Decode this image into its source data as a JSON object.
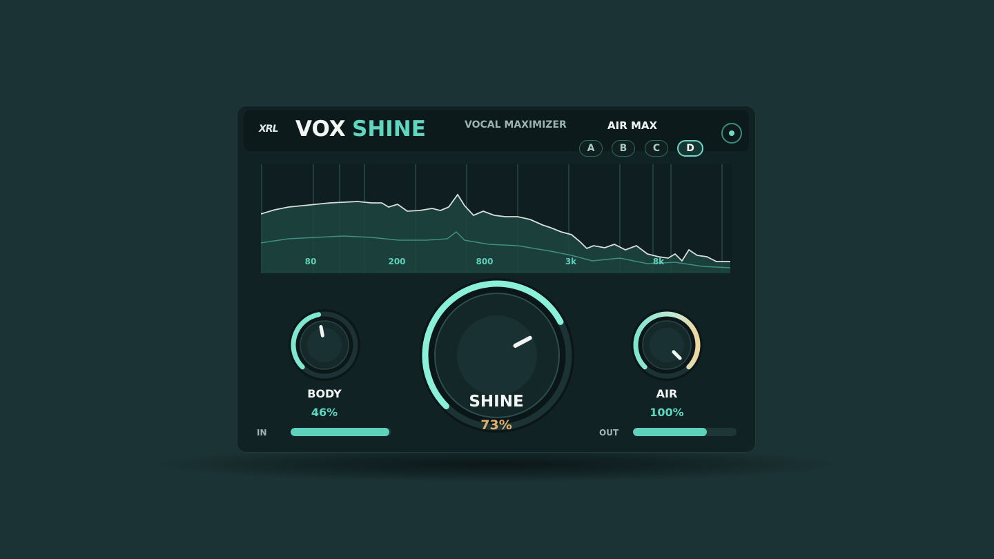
{
  "header": {
    "logo_text": "XRL",
    "title_part1": "VOX",
    "title_part2": "SHINE",
    "subtitle": "VOCAL MAXIMIZER",
    "preset_name": "AIR MAX",
    "ab_slots": [
      "A",
      "B",
      "C",
      "D"
    ],
    "active_slot": "D",
    "power_icon": "power-icon"
  },
  "analyzer": {
    "freq_labels": [
      "80",
      "200",
      "800",
      "3k",
      "8k"
    ]
  },
  "knobs": {
    "body": {
      "label": "BODY",
      "value_text": "46%",
      "value": 0.46
    },
    "shine": {
      "label": "SHINE",
      "value_text": "73%",
      "value": 0.73
    },
    "air": {
      "label": "AIR",
      "value_text": "100%",
      "value": 1.0
    }
  },
  "meters": {
    "in": {
      "label": "IN",
      "level": 0.98
    },
    "out": {
      "label": "OUT",
      "level": 0.71
    }
  },
  "colors": {
    "accent": "#5fd6bf",
    "shine_value": "#e3b06a",
    "air_warm": "#f0d6a0",
    "background": "#1b3335",
    "panel": "#112224"
  }
}
